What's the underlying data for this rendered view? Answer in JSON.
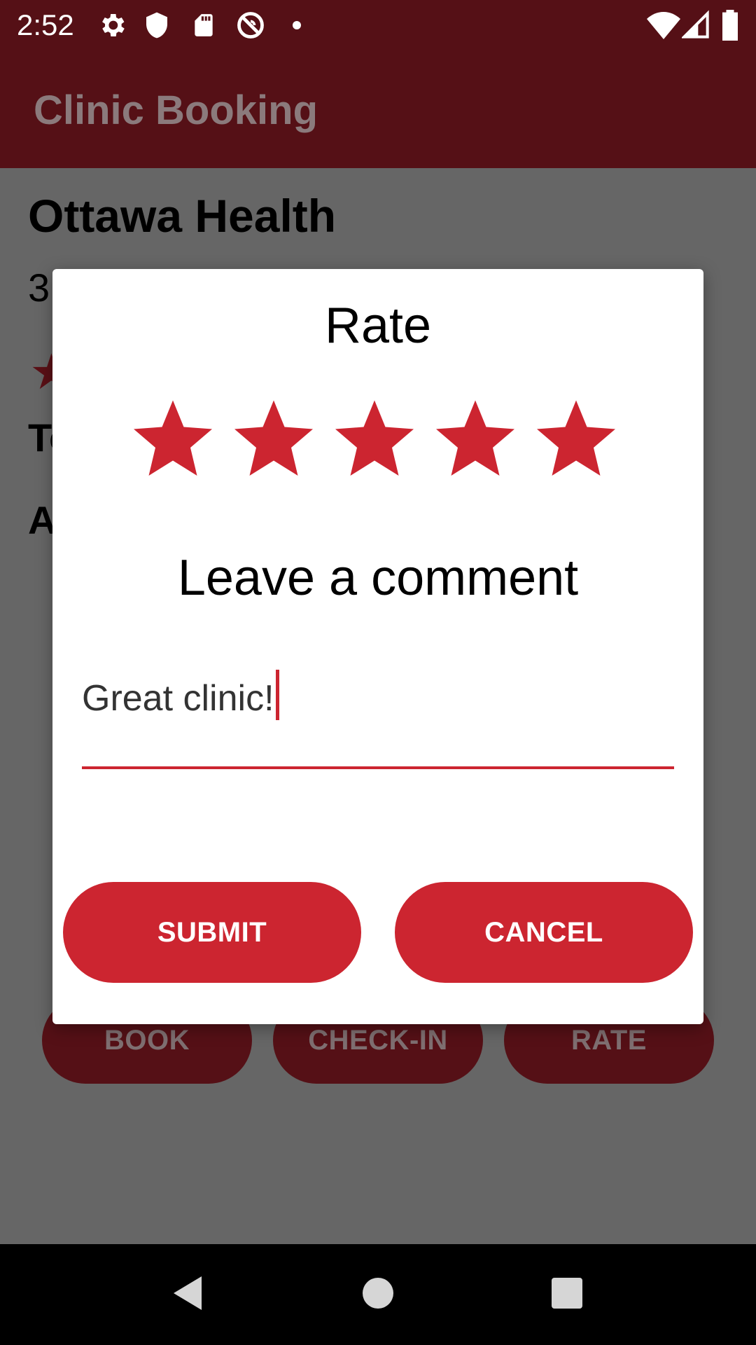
{
  "status_bar": {
    "time": "2:52",
    "icons": [
      "gear-icon",
      "shield-icon",
      "sd-card-icon",
      "no-sync-icon",
      "dot-icon",
      "wifi-icon",
      "signal-icon",
      "battery-icon"
    ]
  },
  "app_bar": {
    "title": "Clinic Booking"
  },
  "background": {
    "clinic_name": "Ottawa Health",
    "line_partial": "3",
    "section_partial_1": "To",
    "section_partial_2": "A",
    "buttons": [
      "BOOK",
      "CHECK-IN",
      "RATE"
    ]
  },
  "dialog": {
    "title": "Rate",
    "rating": {
      "value": 5,
      "max": 5
    },
    "comment_heading": "Leave a comment",
    "comment_value": "Great clinic!",
    "submit_label": "SUBMIT",
    "cancel_label": "CANCEL"
  },
  "colors": {
    "accent": "#cc2530",
    "app_bar": "#551016",
    "scrim": "#666666"
  },
  "nav_bar": {
    "icons": [
      "back-icon",
      "home-icon",
      "recents-icon"
    ]
  }
}
